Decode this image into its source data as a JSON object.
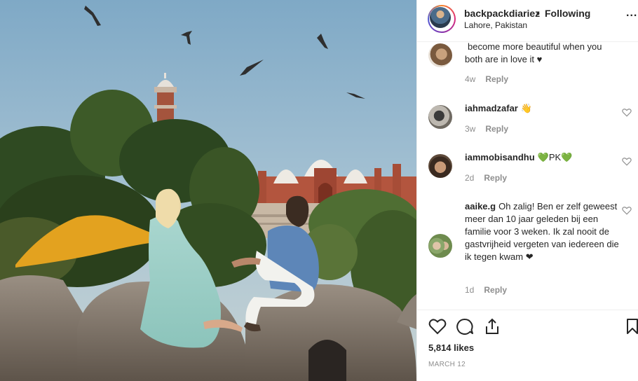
{
  "post": {
    "username": "backpackdiariez",
    "separator": "•",
    "follow_status": "Following",
    "location": "Lahore, Pakistan",
    "more_options": "..."
  },
  "comments": [
    {
      "username": "",
      "text": "become more beautiful when you both are in love it ♥",
      "age": "4w",
      "reply_label": "Reply"
    },
    {
      "username": "iahmadzafar",
      "text": "👋",
      "age": "3w",
      "reply_label": "Reply"
    },
    {
      "username": "iammobisandhu",
      "text": "💚PK💚",
      "age": "2d",
      "reply_label": "Reply"
    },
    {
      "username": "aaike.g",
      "text": "Oh zalig! Ben er zelf geweest meer dan 10 jaar geleden bij een familie voor 3 weken. Ik zal nooit de gastvrijheid vergeten van iedereen die ik tegen kwam ❤",
      "age": "1d",
      "reply_label": "Reply"
    }
  ],
  "footer": {
    "likes": "5,814 likes",
    "date": "MARCH 12"
  },
  "icons": {
    "like": "heart-icon",
    "comment": "comment-icon",
    "share": "share-icon",
    "save": "bookmark-icon",
    "more": "more-icon"
  }
}
